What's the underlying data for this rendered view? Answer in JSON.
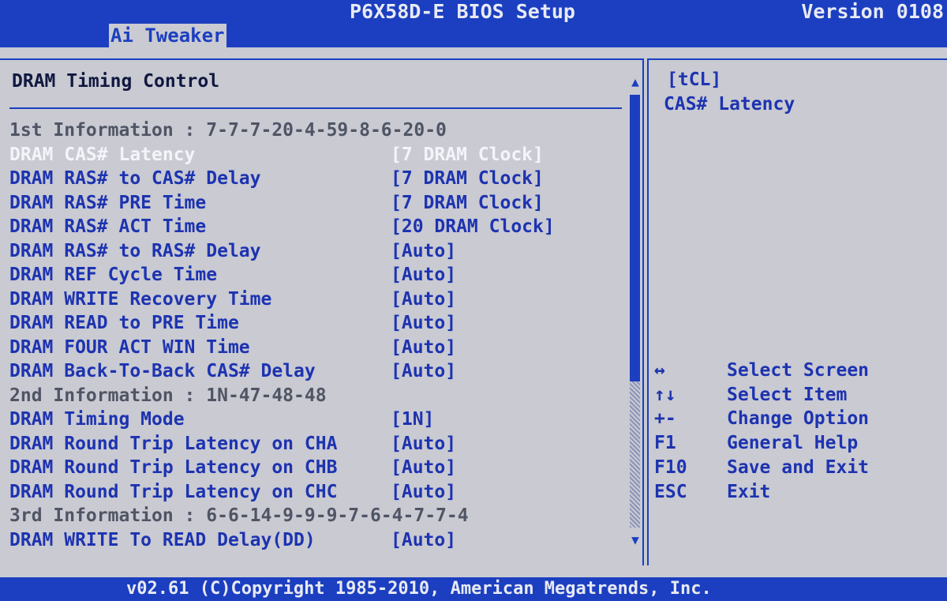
{
  "header": {
    "title": "P6X58D-E BIOS Setup",
    "version": "Version 0108"
  },
  "tabs": [
    {
      "label": "Ai Tweaker",
      "active": true
    }
  ],
  "main": {
    "section_title": "DRAM Timing Control",
    "rows": [
      {
        "label": "1st Information : 7-7-7-20-4-59-8-6-20-0",
        "value": "",
        "type": "info"
      },
      {
        "label": "DRAM CAS# Latency",
        "value": "[7 DRAM Clock]",
        "type": "selected"
      },
      {
        "label": "DRAM RAS# to CAS# Delay",
        "value": "[7 DRAM Clock]",
        "type": "option"
      },
      {
        "label": "DRAM RAS# PRE Time",
        "value": "[7 DRAM Clock]",
        "type": "option"
      },
      {
        "label": "DRAM RAS# ACT Time",
        "value": "[20 DRAM Clock]",
        "type": "option"
      },
      {
        "label": "DRAM RAS# to RAS# Delay",
        "value": "[Auto]",
        "type": "option"
      },
      {
        "label": "DRAM REF Cycle Time",
        "value": "[Auto]",
        "type": "option"
      },
      {
        "label": "DRAM WRITE Recovery Time",
        "value": "[Auto]",
        "type": "option"
      },
      {
        "label": "DRAM READ to PRE Time",
        "value": "[Auto]",
        "type": "option"
      },
      {
        "label": "DRAM FOUR ACT WIN Time",
        "value": "[Auto]",
        "type": "option"
      },
      {
        "label": "DRAM Back-To-Back CAS# Delay",
        "value": "[Auto]",
        "type": "option"
      },
      {
        "label": "2nd Information : 1N-47-48-48",
        "value": "",
        "type": "info"
      },
      {
        "label": "DRAM Timing Mode",
        "value": "[1N]",
        "type": "option"
      },
      {
        "label": "DRAM Round Trip Latency on CHA",
        "value": "[Auto]",
        "type": "option"
      },
      {
        "label": "DRAM Round Trip Latency on CHB",
        "value": "[Auto]",
        "type": "option"
      },
      {
        "label": "DRAM Round Trip Latency on CHC",
        "value": "[Auto]",
        "type": "option"
      },
      {
        "label": "3rd Information : 6-6-14-9-9-9-7-6-4-7-7-4",
        "value": "",
        "type": "info"
      },
      {
        "label": "DRAM WRITE To READ Delay(DD)",
        "value": "[Auto]",
        "type": "option"
      }
    ]
  },
  "help": {
    "key": "[tCL]",
    "description": "CAS# Latency"
  },
  "keys": [
    {
      "key": "↔",
      "desc": "Select Screen"
    },
    {
      "key": "↑↓",
      "desc": "Select Item"
    },
    {
      "key": "+-",
      "desc": "Change Option"
    },
    {
      "key": "F1",
      "desc": "General Help"
    },
    {
      "key": "F10",
      "desc": "Save and Exit"
    },
    {
      "key": "ESC",
      "desc": "Exit"
    }
  ],
  "footer": "v02.61 (C)Copyright 1985-2010, American Megatrends, Inc."
}
